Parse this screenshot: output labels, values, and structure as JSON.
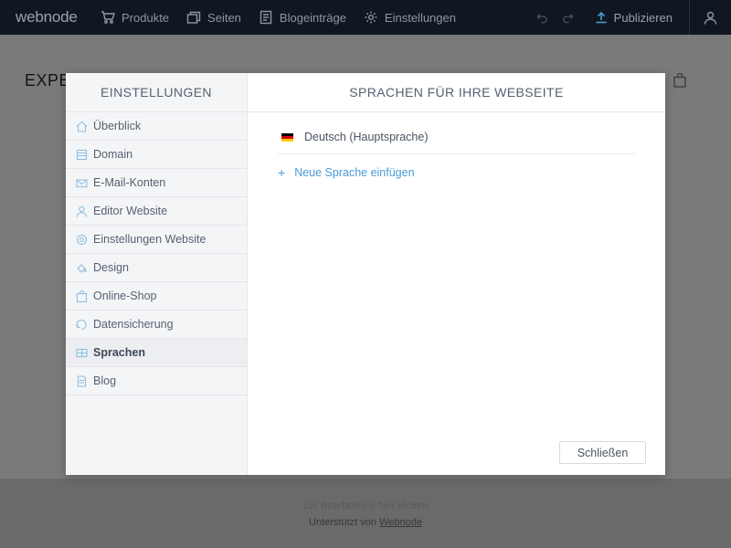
{
  "topbar": {
    "logo": "webnode",
    "nav": [
      {
        "label": "Produkte",
        "icon": "cart-icon"
      },
      {
        "label": "Seiten",
        "icon": "pages-icon"
      },
      {
        "label": "Blogeinträge",
        "icon": "document-icon"
      },
      {
        "label": "Einstellungen",
        "icon": "gear-icon"
      }
    ],
    "publish_label": "Publizieren"
  },
  "background": {
    "heading": "EXPE",
    "footer_line1": "Zur Bearbeitung hier klicken",
    "footer_line2_prefix": "Unterstützt von",
    "footer_line2_link": "Webnode"
  },
  "modal": {
    "sidebar_title": "EINSTELLUNGEN",
    "sidebar_items": [
      {
        "label": "Überblick",
        "icon": "home-icon"
      },
      {
        "label": "Domain",
        "icon": "domain-icon"
      },
      {
        "label": "E-Mail-Konten",
        "icon": "envelope-icon"
      },
      {
        "label": "Editor Website",
        "icon": "user-icon"
      },
      {
        "label": "Einstellungen Website",
        "icon": "gear-icon"
      },
      {
        "label": "Design",
        "icon": "paint-bucket-icon"
      },
      {
        "label": "Online-Shop",
        "icon": "shopping-bag-icon"
      },
      {
        "label": "Datensicherung",
        "icon": "backup-icon"
      },
      {
        "label": "Sprachen",
        "icon": "languages-icon",
        "active": true
      },
      {
        "label": "Blog",
        "icon": "blog-document-icon"
      }
    ],
    "content_title": "SPRACHEN FÜR IHRE WEBSEITE",
    "languages": [
      {
        "label": "Deutsch (Hauptsprache)",
        "flag_colors": [
          "#000000",
          "#dd0000",
          "#ffce00"
        ]
      }
    ],
    "add_language_label": "Neue Sprache einfügen",
    "close_label": "Schließen"
  },
  "colors": {
    "accent": "#4a9bd6",
    "topbar_bg": "#111720",
    "sidebar_bg": "#f4f5f7"
  }
}
